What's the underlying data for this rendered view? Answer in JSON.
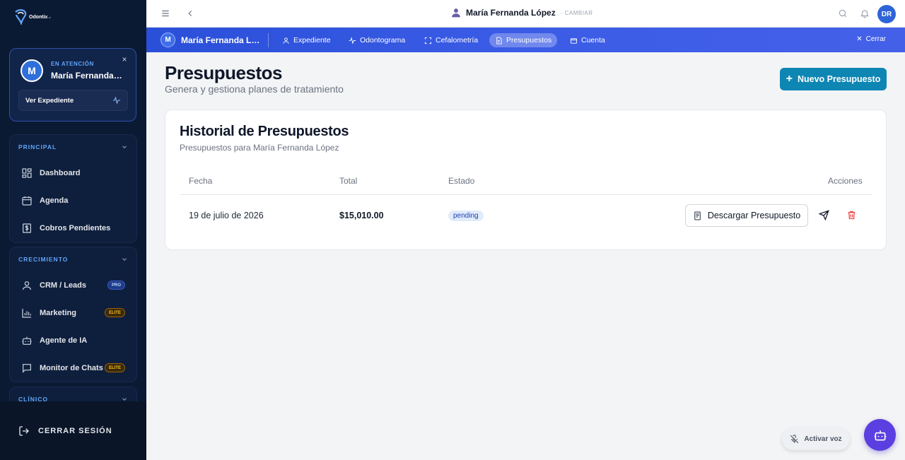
{
  "app": {
    "logo_text": "Odontix",
    "logo_sub": ".ai"
  },
  "sidebar": {
    "attention": {
      "label": "EN ATENCIÓN",
      "avatar_letter": "M",
      "patient_name": "María Fernanda López",
      "view_record": "Ver Expediente"
    },
    "sections": [
      {
        "title": "PRINCIPAL",
        "items": [
          {
            "label": "Dashboard",
            "icon": "dashboard-icon"
          },
          {
            "label": "Agenda",
            "icon": "calendar-icon"
          },
          {
            "label": "Cobros Pendientes",
            "icon": "receipt-icon"
          }
        ]
      },
      {
        "title": "CRECIMIENTO",
        "items": [
          {
            "label": "CRM / Leads",
            "icon": "user-icon",
            "badge": "PRO"
          },
          {
            "label": "Marketing",
            "icon": "bar-chart-icon",
            "badge": "ELITE"
          },
          {
            "label": "Agente de IA",
            "icon": "bot-icon"
          },
          {
            "label": "Monitor de Chats",
            "icon": "chat-icon",
            "badge": "ELITE"
          }
        ]
      },
      {
        "title": "CLÍNICO"
      }
    ],
    "logout": "CERRAR SESIÓN"
  },
  "topbar": {
    "patient_name": "María Fernanda López",
    "change_label": "· CAMBIAR",
    "user_initials": "DR"
  },
  "patient_bar": {
    "avatar_letter": "M",
    "name": "María Fernanda López",
    "tabs": [
      {
        "label": "Expediente",
        "icon": "user-icon"
      },
      {
        "label": "Odontograma",
        "icon": "activity-icon"
      },
      {
        "label": "Cefalometría",
        "icon": "scan-icon"
      },
      {
        "label": "Presupuestos",
        "icon": "document-icon",
        "active": true
      },
      {
        "label": "Cuenta",
        "icon": "wallet-icon"
      }
    ],
    "close_label": "Cerrar"
  },
  "main": {
    "title": "Presupuestos",
    "subtitle": "Genera y gestiona planes de tratamiento",
    "new_button": "Nuevo Presupuesto",
    "history": {
      "title": "Historial de Presupuestos",
      "subtitle": "Presupuestos para María Fernanda López",
      "columns": [
        "Fecha",
        "Total",
        "Estado",
        "Acciones"
      ],
      "rows": [
        {
          "date": "19 de julio de 2026",
          "total": "$15,010.00",
          "status": "pending",
          "download_label": "Descargar Presupuesto"
        }
      ]
    }
  },
  "floating": {
    "voice_label": "Activar voz"
  },
  "colors": {
    "sidebar_bg": "#0b1a33",
    "accent": "#0e86b3",
    "patient_bar": "#3b5ce6",
    "bot": "#5b3fe0",
    "danger": "#ef4444"
  }
}
